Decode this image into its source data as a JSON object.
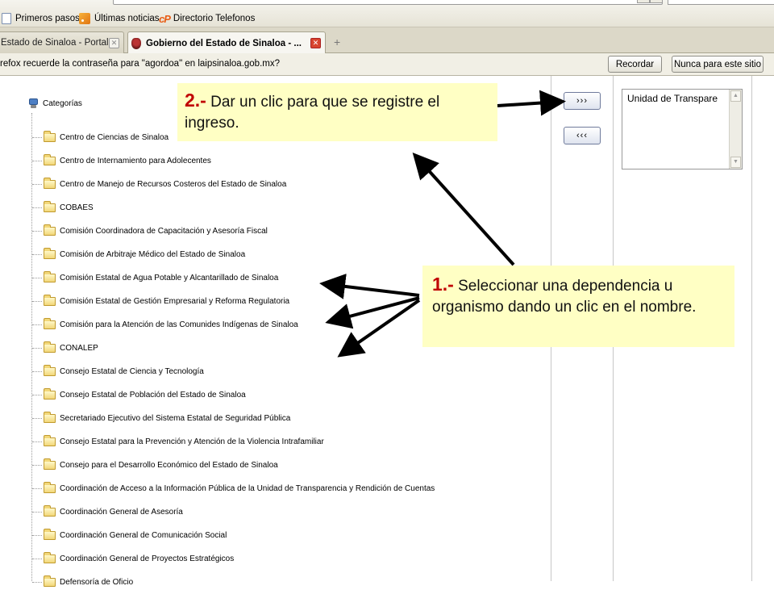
{
  "browser": {
    "bookmarks": [
      {
        "label": "Primeros pasos",
        "icon": "page-icon"
      },
      {
        "label": "Últimas noticias",
        "icon": "rss-icon"
      },
      {
        "label": "Directorio Telefonos",
        "icon": "cp-logo-icon",
        "icon_text": "cP"
      }
    ],
    "tabs": [
      {
        "label": "Estado de Sinaloa - Portal ...",
        "active": false
      },
      {
        "label": "Gobierno del Estado de Sinaloa - ...",
        "active": true
      }
    ],
    "new_tab_glyph": "+",
    "notification": {
      "text": "refox recuerde la contraseña para \"agordoa\" en laipsinaloa.gob.mx?",
      "remember_label": "Recordar",
      "never_label": "Nunca para este sitio"
    }
  },
  "page": {
    "tree": {
      "root_label": "Categorías",
      "items": [
        "Centro de Ciencias de Sinaloa",
        "Centro de Internamiento para Adolecentes",
        "Centro de Manejo de Recursos Costeros del Estado de Sinaloa",
        "COBAES",
        "Comisión Coordinadora de Capacitación y Asesoría Fiscal",
        "Comisión de Arbitraje Médico del Estado de Sinaloa",
        "Comisión Estatal de Agua Potable y Alcantarillado de Sinaloa",
        "Comisión Estatal de Gestión Empresarial y Reforma Regulatoria",
        "Comisión para la Atención de las Comunides Indígenas de Sinaloa",
        "CONALEP",
        "Consejo Estatal de Ciencia y Tecnología",
        "Consejo Estatal de Población del Estado de Sinaloa",
        "Secretariado Ejecutivo del Sistema Estatal de Seguridad Pública",
        "Consejo Estatal para la Prevención y Atención de la Violencia Intrafamiliar",
        "Consejo para el Desarrollo Económico del Estado de Sinaloa",
        "Coordinación de Acceso a la Información Pública de la Unidad de Transparencia y Rendición de Cuentas",
        "Coordinación General de Asesoría",
        "Coordinación General de Comunicación Social",
        "Coordinación General de Proyectos Estratégicos",
        "Defensoría de Oficio"
      ]
    },
    "add_button_label": "›››",
    "remove_button_label": "‹‹‹",
    "selected_list": [
      "Unidad de Transpare"
    ]
  },
  "callouts": {
    "step2": {
      "number": "2.-",
      "text": "Dar un clic para que se registre el ingreso."
    },
    "step1": {
      "number": "1.-",
      "text": "Seleccionar una dependencia u organismo dando un clic en el nombre."
    }
  },
  "colors": {
    "callout_bg": "#ffffc4",
    "callout_number": "#c00000",
    "arrow": "#000000"
  }
}
